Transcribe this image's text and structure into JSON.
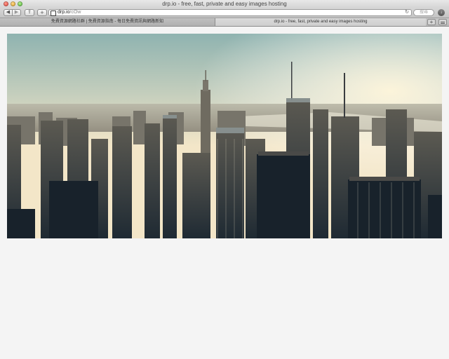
{
  "window": {
    "title": "drp.io - free, fast, private and easy images hosting"
  },
  "toolbar": {
    "back_glyph": "◀",
    "forward_glyph": "▶",
    "share_glyph": "⇪",
    "newtab_glyph": "+",
    "url_host": "drp.io",
    "url_path": "/cOw",
    "reload_glyph": "↻",
    "search_placeholder": "搜尋",
    "downloads_glyph": "↓"
  },
  "tabs": [
    {
      "label": "免費資源網路社群 | 免費資源指南 - 每日免費資訊與網路新知"
    },
    {
      "label": "drp.io - free, fast, private and easy images hosting"
    }
  ],
  "tabbar": {
    "add_glyph": "+"
  },
  "content": {
    "image_subject": "city-skyline-photo"
  },
  "colors": {
    "sky_top": "#8fb3b0",
    "sky_horizon": "#f3e6c8",
    "sun_glow": "#fff6dc",
    "city_dark": "#1f2a33",
    "city_mid": "#5c5a52",
    "page_background": "#f4f4f4"
  },
  "icons": [
    "close-icon",
    "minimize-icon",
    "zoom-icon",
    "back-icon",
    "forward-icon",
    "share-icon",
    "new-tab-icon",
    "site-favicon",
    "reload-icon",
    "downloads-icon",
    "tab-overview-icon"
  ]
}
